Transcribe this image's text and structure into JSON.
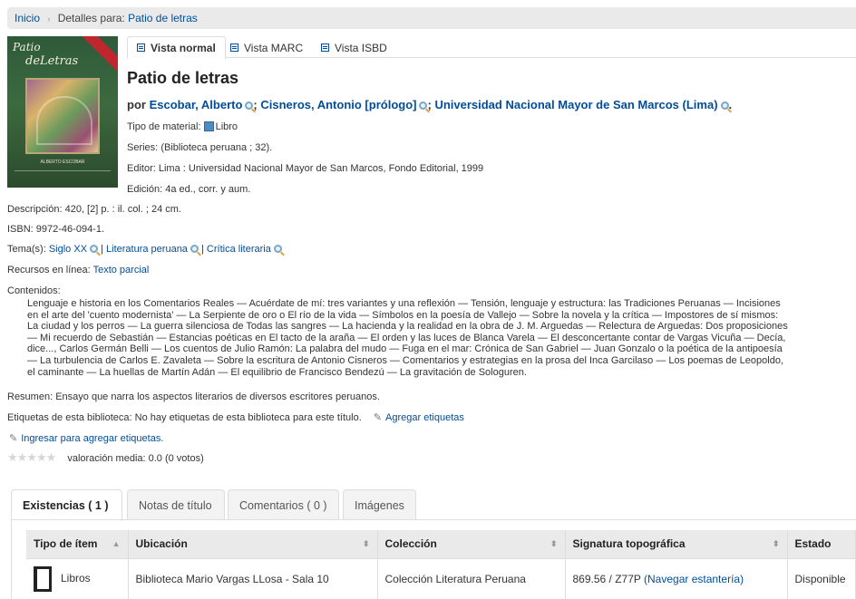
{
  "breadcrumb": {
    "home": "Inicio",
    "details_prefix": "Detalles para:",
    "current": "Patio de letras"
  },
  "cover": {
    "title_line1": "Patio",
    "title_line2": "deLetras",
    "author": "ALBERTO ESCOBAR",
    "colors": {
      "background": "#2f5a3a",
      "ribbon": "#c0262d"
    }
  },
  "view_tabs": [
    {
      "label": "Vista normal",
      "active": true
    },
    {
      "label": "Vista MARC",
      "active": false
    },
    {
      "label": "Vista ISBD",
      "active": false
    }
  ],
  "record": {
    "title": "Patio de letras",
    "authors": {
      "prefix": "por",
      "a1": "Escobar, Alberto",
      "a2": "Cisneros, Antonio [prólogo]",
      "a3": "Universidad Nacional Mayor de San Marcos (Lima)"
    },
    "material_label": "Tipo de material:",
    "material_value": "Libro",
    "series_label": "Series:",
    "series_value": "(Biblioteca peruana ; 32).",
    "publisher_label": "Editor:",
    "publisher_value": "Lima : Universidad Nacional Mayor de San Marcos, Fondo Editorial, 1999",
    "edition_label": "Edición:",
    "edition_value": "4a ed., corr. y aum.",
    "description_label": "Descripción:",
    "description_value": "420, [2] p. : il. col. ; 24 cm.",
    "isbn_label": "ISBN:",
    "isbn_value": "9972-46-094-1.",
    "subjects_label": "Tema(s):",
    "subjects": [
      "Siglo XX",
      "Literatura peruana",
      "Crítica literaria"
    ],
    "online_label": "Recursos en línea:",
    "online_value": "Texto parcial",
    "contents_label": "Contenidos:",
    "contents_value": "Lenguaje e historia en los Comentarios Reales — Acuérdate de mí: tres variantes y una reflexión — Tensión, lenguaje y estructura: las Tradiciones Peruanas — Incisiones en el arte del 'cuento modernista' — La Serpiente de oro o El río de la vida — Símbolos en la poesía de Vallejo — Sobre la novela y la crítica — Impostores de sí mismos: La ciudad y los perros — La guerra silenciosa de Todas las sangres — La hacienda y la realidad en la obra de J. M. Arguedas — Relectura de Arguedas: Dos proposiciones — Mi recuerdo de Sebastián — Estancias poéticas en El tacto de la araña — El orden y las luces de Blanca Varela — El desconcertante contar de Vargas Vicuña — Decía, dice..., Carlos Germán Belli — Los cuentos de Julio Ramón: La palabra del mudo — Fuga en el mar: Crónica de San Gabriel — Juan Gonzalo o la poética de la antipoesía — La turbulencia de Carlos E. Zavaleta — Sobre la escritura de Antonio Cisneros — Comentarios y estrategias en la prosa del Inca Garcilaso — Los poemas de Leopoldo, el caminante — La huellas de Martín Adán — El equilibrio de Francisco Bendezú — La gravitación de Sologuren.",
    "summary_label": "Resumen:",
    "summary_value": "Ensayo que narra los aspectos literarios de diversos escritores peruanos.",
    "tags_label": "Etiquetas de esta biblioteca:",
    "tags_value": "No hay etiquetas de esta biblioteca para este título.",
    "add_tags": "Agregar etiquetas",
    "login_tags": "Ingresar para agregar etiquetas.",
    "rating_text": "valoración media: 0.0 (0 votos)",
    "rating_value": 0
  },
  "holdings_tabs": [
    {
      "label": "Existencias ( 1 )",
      "active": true
    },
    {
      "label": "Notas de título",
      "active": false
    },
    {
      "label": "Comentarios ( 0 )",
      "active": false
    },
    {
      "label": "Imágenes",
      "active": false
    }
  ],
  "holdings_table": {
    "headers": [
      "Tipo de ítem",
      "Ubicación",
      "Colección",
      "Signatura topográfica",
      "Estado"
    ],
    "rows": [
      {
        "type": "Libros",
        "location": "Biblioteca Mario Vargas LLosa - Sala 10",
        "collection": "Colección Literatura Peruana",
        "call_number": "869.56 / Z77P",
        "browse": "(Navegar estantería)",
        "status": "Disponible"
      }
    ]
  },
  "colors": {
    "link": "#004d99",
    "header_bg": "#eaeaea",
    "border": "#dddddd"
  }
}
